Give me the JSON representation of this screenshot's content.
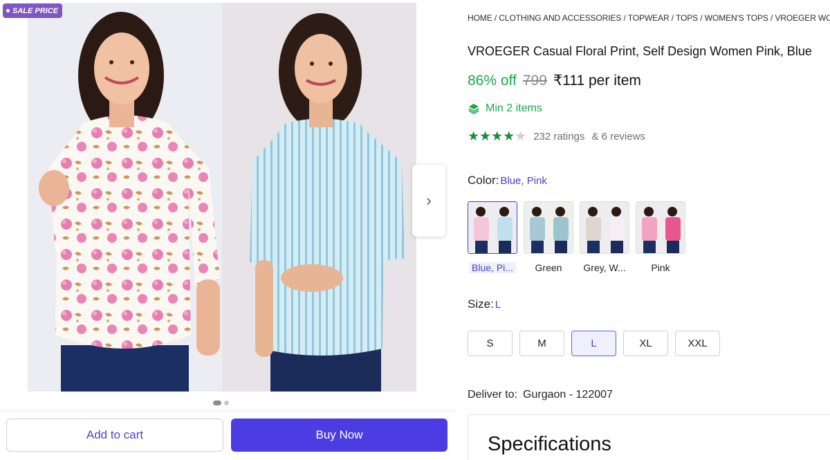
{
  "gallery": {
    "sale_badge": "SALE PRICE",
    "dots": 2,
    "active_dot": 0,
    "add_to_cart": "Add to cart",
    "buy_now": "Buy Now"
  },
  "product": {
    "breadcrumb": "HOME / CLOTHING AND ACCESSORIES / TOPWEAR / TOPS / WOMEN'S TOPS / VROEGER WOM",
    "title": "VROEGER Casual Floral Print, Self Design Women Pink, Blue",
    "discount": "86% off",
    "mrp": "799",
    "price": "₹111 per item",
    "min_items": "Min 2 items",
    "rating_stars": 4,
    "ratings": "232 ratings",
    "reviews": "& 6 reviews",
    "color_label": "Color:",
    "color_value": "Blue, Pink",
    "colors": [
      {
        "name": "Blue, Pi...",
        "selected": true
      },
      {
        "name": "Green",
        "selected": false
      },
      {
        "name": "Grey, W...",
        "selected": false
      },
      {
        "name": "Pink",
        "selected": false
      }
    ],
    "size_label": "Size:",
    "size_value": "L",
    "sizes": [
      "S",
      "M",
      "L",
      "XL",
      "XXL"
    ],
    "selected_size": "L",
    "deliver_label": "Deliver to:",
    "deliver_location": "Gurgaon - 122007",
    "specifications": "Specifications"
  },
  "colors": {
    "accent": "#4c3de3",
    "discount_green": "#1ca84a",
    "star_green": "#1f8a3c",
    "badge_purple": "#7e57c2"
  }
}
